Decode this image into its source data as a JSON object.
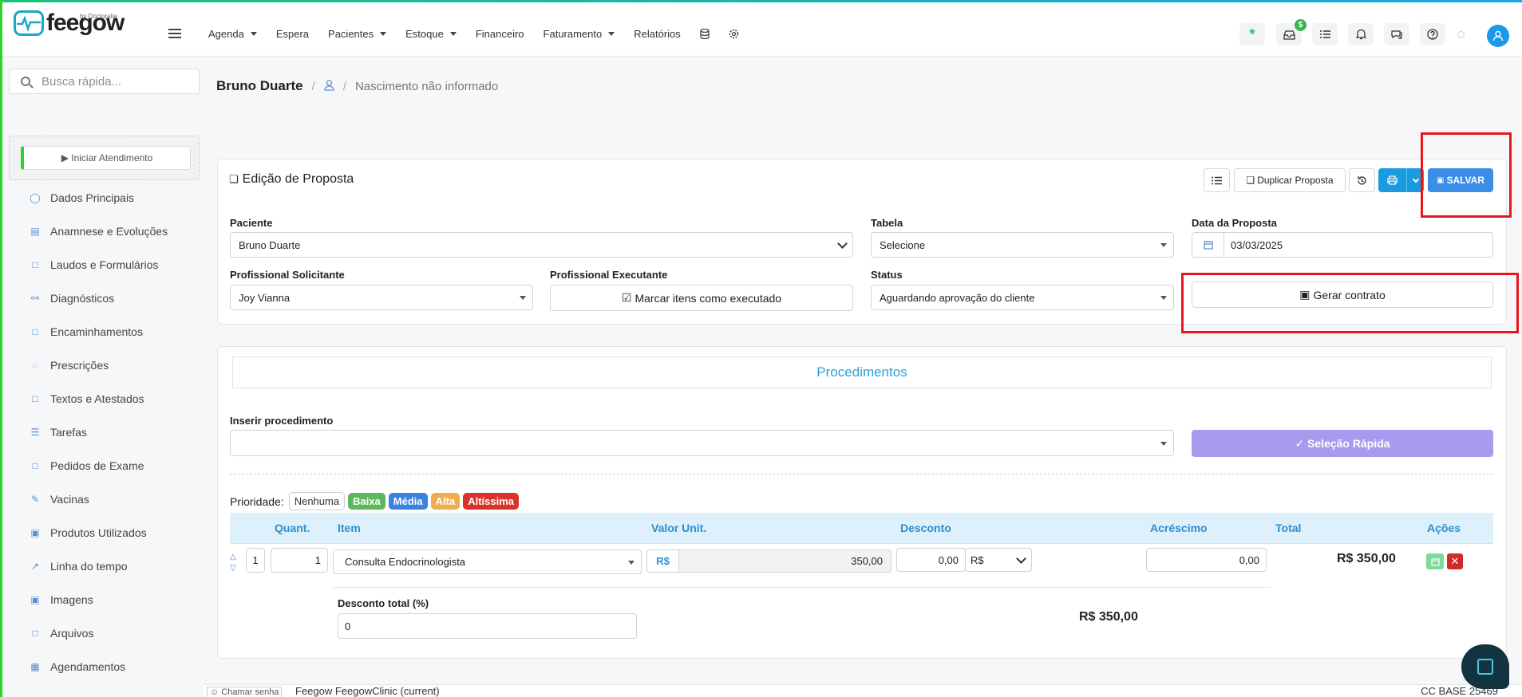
{
  "brand": {
    "name": "feegow",
    "by": "by Doctoralia"
  },
  "nav": [
    {
      "label": "Agenda",
      "dropdown": true
    },
    {
      "label": "Espera",
      "dropdown": false
    },
    {
      "label": "Pacientes",
      "dropdown": true
    },
    {
      "label": "Estoque",
      "dropdown": true
    },
    {
      "label": "Financeiro",
      "dropdown": false
    },
    {
      "label": "Faturamento",
      "dropdown": true
    },
    {
      "label": "Relatórios",
      "dropdown": false
    }
  ],
  "topbar": {
    "wallet_badge": "$"
  },
  "sidebar": {
    "search_placeholder": "Busca rápida...",
    "start_button": "▶ Iniciar Atendimento",
    "items": [
      {
        "label": "Dados Principais",
        "icon": "user-icon"
      },
      {
        "label": "Anamnese e Evoluções",
        "icon": "chart-icon"
      },
      {
        "label": "Laudos e Formulários",
        "icon": "clipboard-icon"
      },
      {
        "label": "Diagnósticos",
        "icon": "stethoscope-icon"
      },
      {
        "label": "Encaminhamentos",
        "icon": "document-icon"
      },
      {
        "label": "Prescrições",
        "icon": "pills-icon"
      },
      {
        "label": "Textos e Atestados",
        "icon": "file-icon"
      },
      {
        "label": "Tarefas",
        "icon": "tasks-icon"
      },
      {
        "label": "Pedidos de Exame",
        "icon": "exam-icon"
      },
      {
        "label": "Vacinas",
        "icon": "syringe-icon"
      },
      {
        "label": "Produtos Utilizados",
        "icon": "box-icon"
      },
      {
        "label": "Linha do tempo",
        "icon": "timeline-icon"
      },
      {
        "label": "Imagens",
        "icon": "camera-icon"
      },
      {
        "label": "Arquivos",
        "icon": "folder-icon"
      },
      {
        "label": "Agendamentos",
        "icon": "calendar-icon"
      }
    ]
  },
  "breadcrumb": {
    "patient": "Bruno Duarte",
    "birth": "Nascimento não informado"
  },
  "proposal": {
    "title": "Edição de Proposta",
    "duplicate": "Duplicar Proposta",
    "save": "SALVAR",
    "paciente_label": "Paciente",
    "paciente_value": "Bruno Duarte",
    "tabela_label": "Tabela",
    "tabela_value": "Selecione",
    "data_label": "Data da Proposta",
    "data_value": "03/03/2025",
    "solicitante_label": "Profissional Solicitante",
    "solicitante_value": "Joy Vianna",
    "executante_label": "Profissional Executante",
    "executante_button": "Marcar itens como executado",
    "status_label": "Status",
    "status_value": "Aguardando aprovação do cliente",
    "contract_button": "Gerar contrato"
  },
  "procedures": {
    "tab": "Procedimentos",
    "insert_label": "Inserir procedimento",
    "quick_select": "✓ Seleção Rápida",
    "priority_label": "Prioridade:",
    "priorities": [
      {
        "label": "Nenhuma",
        "bg": "#ffffff",
        "fg": "#333333"
      },
      {
        "label": "Baixa",
        "bg": "#5cb85c",
        "fg": "#ffffff"
      },
      {
        "label": "Média",
        "bg": "#3b82e0",
        "fg": "#ffffff"
      },
      {
        "label": "Alta",
        "bg": "#f0ad4e",
        "fg": "#ffffff"
      },
      {
        "label": "Altíssima",
        "bg": "#d9342b",
        "fg": "#ffffff"
      }
    ],
    "columns": [
      "Quant.",
      "Item",
      "Valor Unit.",
      "Desconto",
      "Acréscimo",
      "Total",
      "Ações"
    ],
    "row": {
      "index": "1",
      "quantity": "1",
      "item": "Consulta Endocrinologista",
      "currency": "R$",
      "unit_value": "350,00",
      "discount": "0,00",
      "discount_type": "R$",
      "addition": "0,00",
      "total": "R$ 350,00"
    },
    "discount_total_label": "Desconto total (%)",
    "discount_total_value": "0",
    "grand_total": "R$ 350,00"
  },
  "footer": {
    "call": "Chamar senha",
    "unit": "Feegow FeegowClinic (current)",
    "base": "CC BASE 25469"
  }
}
